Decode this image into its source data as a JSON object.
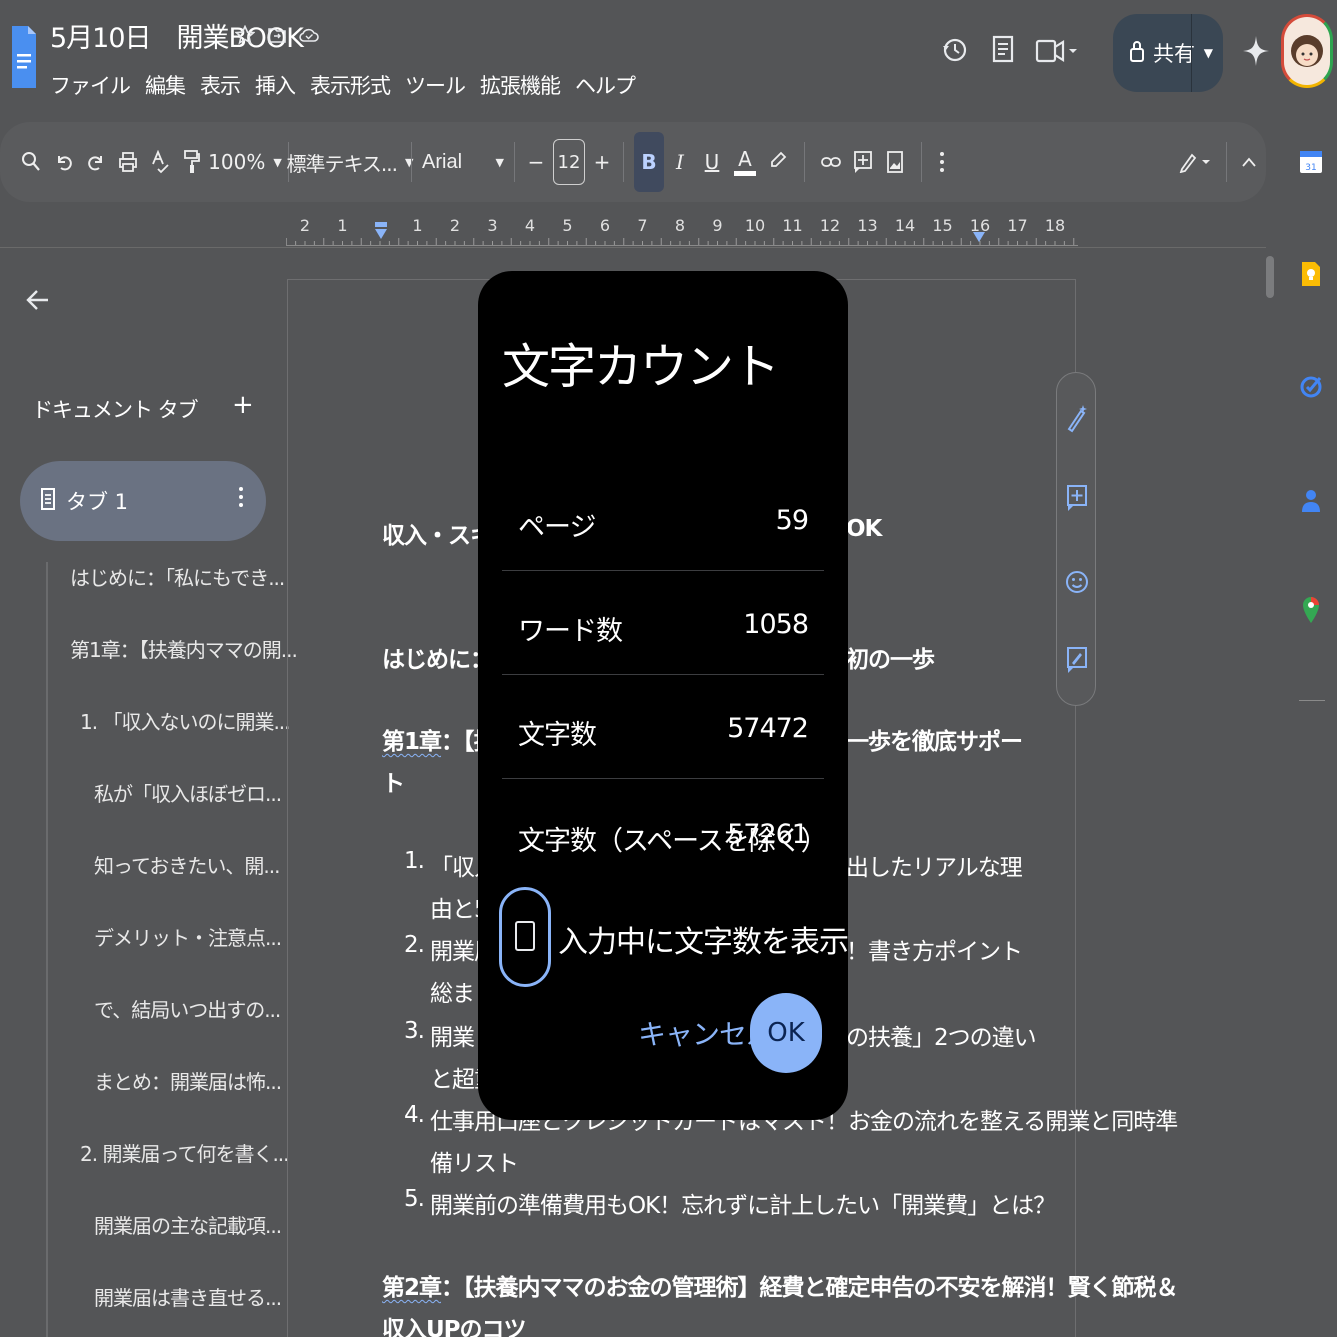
{
  "doc": {
    "title": "5月10日　開業BOOK",
    "menu": [
      "ファイル",
      "編集",
      "表示",
      "挿入",
      "表示形式",
      "ツール",
      "拡張機能",
      "ヘルプ"
    ]
  },
  "share": {
    "label": "共有"
  },
  "toolbar": {
    "zoom": "100%",
    "style": "標準テキス...",
    "font": "Arial",
    "font_size": "12",
    "minus": "−",
    "plus": "+",
    "bold": "B",
    "italic": "I",
    "underline": "U",
    "text_color": "A"
  },
  "ruler": {
    "numbers": [
      "2",
      "1",
      "1",
      "2",
      "3",
      "4",
      "5",
      "6",
      "7",
      "8",
      "9",
      "10",
      "11",
      "12",
      "13",
      "14",
      "15",
      "16",
      "17",
      "18"
    ]
  },
  "sidebar": {
    "tabs_label": "ドキュメント タブ",
    "add": "+",
    "tab1": "タブ 1",
    "outline": [
      "はじめに：「私にもでき...",
      "第1章：【扶養内ママの開...",
      "1. 「収入ないのに開業...",
      "私が「収入ほぼゼロ...",
      "知っておきたい、開...",
      "デメリット・注意点...",
      "で、結局いつ出すの...",
      "まとめ：開業届は怖...",
      "2. 開業届って何を書く...",
      "開業届の主な記載項...",
      "開業届は書き直せる..."
    ]
  },
  "document": {
    "line1_left": "収入・スキル",
    "line1_right": "OK",
    "line2_left": "はじめに：「",
    "line2_right": "初の一歩",
    "ch1_prefix": "第1章",
    "ch1_left": "：【扶",
    "ch1_right": "一歩を徹底サポー",
    "ch1_wrap": "ト",
    "items": [
      {
        "num": "1.",
        "left": "「収入",
        "right": "出したリアルな理",
        "wrap": "由と5"
      },
      {
        "num": "2.",
        "left": "開業届",
        "right": "！書き方ポイント",
        "wrap": "総まと"
      },
      {
        "num": "3.",
        "left": "開業し",
        "right": "の扶養」2つの違い",
        "wrap": "と超重"
      },
      {
        "num": "4.",
        "left": "仕事用口座とクレジットカードはマスト！お金の流れを整える開業と同時準",
        "wrap": "備リスト"
      },
      {
        "num": "5.",
        "left": "開業前の準備費用もOK！忘れずに計上したい「開業費」とは？"
      }
    ],
    "ch2_prefix": "第2章",
    "ch2_line": "：【扶養内ママのお金の管理術】経費と確定申告の不安を解消！賢く節税＆",
    "ch2_wrap": "収入UPのコツ"
  },
  "dialog": {
    "title": "文字カウント",
    "rows": [
      {
        "label": "ページ",
        "value": "59"
      },
      {
        "label": "ワード数",
        "value": "1058"
      },
      {
        "label": "文字数",
        "value": "57472"
      },
      {
        "label": "文字数（スペースを除く）",
        "value": "57261"
      }
    ],
    "checkbox_label": "入力中に文字数を表示",
    "cancel": "キャンセル",
    "ok": "OK"
  },
  "colors": {
    "accent": "#8ab4f8",
    "background": "#545557",
    "dialog": "#000000"
  }
}
